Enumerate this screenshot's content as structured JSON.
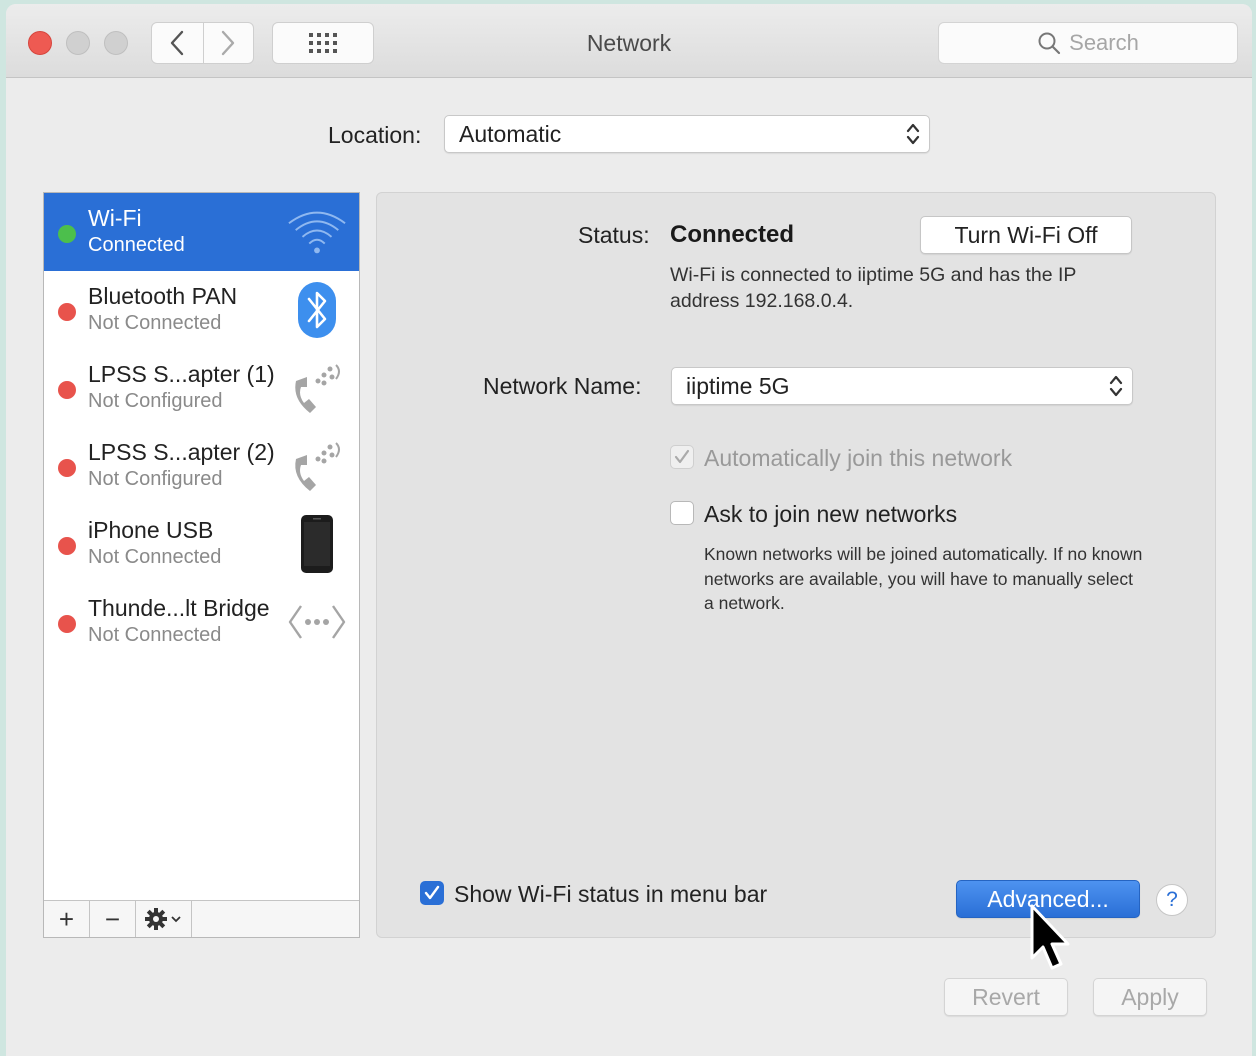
{
  "window": {
    "title": "Network",
    "search_placeholder": "Search"
  },
  "location": {
    "label": "Location:",
    "value": "Automatic"
  },
  "services": [
    {
      "name": "Wi-Fi",
      "status": "Connected",
      "state": "connected",
      "selected": true,
      "icon": "wifi-icon"
    },
    {
      "name": "Bluetooth PAN",
      "status": "Not Connected",
      "state": "disconnected",
      "selected": false,
      "icon": "bluetooth-icon"
    },
    {
      "name": "LPSS S...apter (1)",
      "status": "Not Configured",
      "state": "disconnected",
      "selected": false,
      "icon": "phone-modem-icon"
    },
    {
      "name": "LPSS S...apter (2)",
      "status": "Not Configured",
      "state": "disconnected",
      "selected": false,
      "icon": "phone-modem-icon"
    },
    {
      "name": "iPhone USB",
      "status": "Not Connected",
      "state": "disconnected",
      "selected": false,
      "icon": "iphone-icon"
    },
    {
      "name": "Thunde...lt Bridge",
      "status": "Not Connected",
      "state": "disconnected",
      "selected": false,
      "icon": "thunderbolt-bridge-icon"
    }
  ],
  "sidebar_tools": {
    "add": "+",
    "remove": "−",
    "action": "gear-icon"
  },
  "detail": {
    "status_label": "Status:",
    "status_value": "Connected",
    "turn_off_button": "Turn Wi-Fi Off",
    "status_description": "Wi-Fi is connected to iiptime 5G and has the IP address 192.168.0.4.",
    "network_name_label": "Network Name:",
    "network_name_value": "iiptime 5G",
    "auto_join_label": "Automatically join this network",
    "auto_join_checked": true,
    "auto_join_disabled": true,
    "ask_join_label": "Ask to join new networks",
    "ask_join_checked": false,
    "ask_join_description": "Known networks will be joined automatically. If no known networks are available, you will have to manually select a network."
  },
  "footer": {
    "show_status_label": "Show Wi-Fi status in menu bar",
    "show_status_checked": true,
    "advanced_button": "Advanced...",
    "help_button": "?",
    "revert_button": "Revert",
    "apply_button": "Apply"
  },
  "colors": {
    "accent": "#2a6fd6",
    "connected": "#4cbf4c",
    "disconnected": "#e8534c",
    "close": "#ee5a52"
  }
}
